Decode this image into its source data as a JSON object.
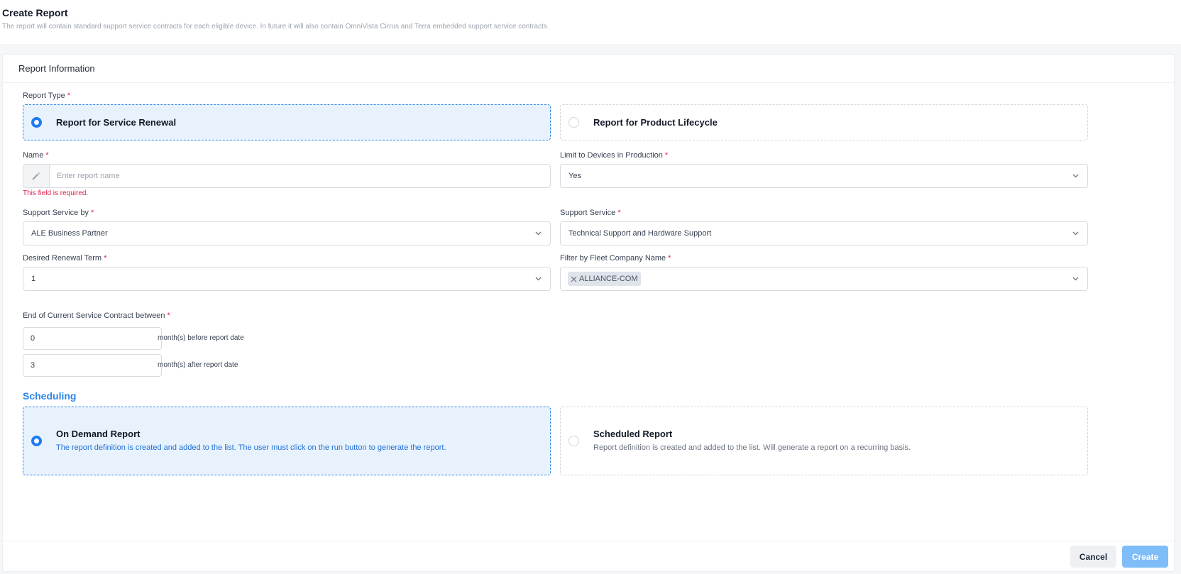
{
  "page": {
    "title": "Create Report",
    "subtitle": "The report will contain standard support service contracts for each eligible device. In future it will also contain OmniVista Cirrus and Terra embedded support service contracts."
  },
  "card": {
    "title": "Report Information"
  },
  "report_type": {
    "label": "Report Type",
    "options": [
      {
        "title": "Report for Service Renewal",
        "selected": true
      },
      {
        "title": "Report for Product Lifecycle",
        "selected": false
      }
    ]
  },
  "name_field": {
    "label": "Name",
    "placeholder": "Enter report name",
    "value": "",
    "error": "This field is required."
  },
  "limit_devices": {
    "label": "Limit to Devices in Production",
    "value": "Yes"
  },
  "support_service_by": {
    "label": "Support Service by",
    "value": "ALE Business Partner"
  },
  "support_service": {
    "label": "Support Service",
    "value": "Technical Support and Hardware Support"
  },
  "renewal_term": {
    "label": "Desired Renewal Term",
    "value": "1"
  },
  "fleet_company": {
    "label": "Filter by Fleet Company Name",
    "tags": [
      "ALLIANCE-COM"
    ]
  },
  "contract_end": {
    "label": "End of Current Service Contract between",
    "before_value": "0",
    "before_unit": "month(s) before report date",
    "after_value": "3",
    "after_unit": "month(s) after report date"
  },
  "scheduling": {
    "title": "Scheduling",
    "options": [
      {
        "title": "On Demand Report",
        "description": "The report definition is created and added to the list. The user must click on the run button to generate the report.",
        "selected": true
      },
      {
        "title": "Scheduled Report",
        "description": "Report definition is created and added to the list. Will generate a report on a recurring basis.",
        "selected": false
      }
    ]
  },
  "footer": {
    "cancel_label": "Cancel",
    "create_label": "Create"
  },
  "required_mark": "*",
  "colors": {
    "accent": "#2b86e8",
    "error": "#e11d48",
    "selected_bg": "#e8f2fd",
    "create_disabled": "#7fbdf8"
  }
}
